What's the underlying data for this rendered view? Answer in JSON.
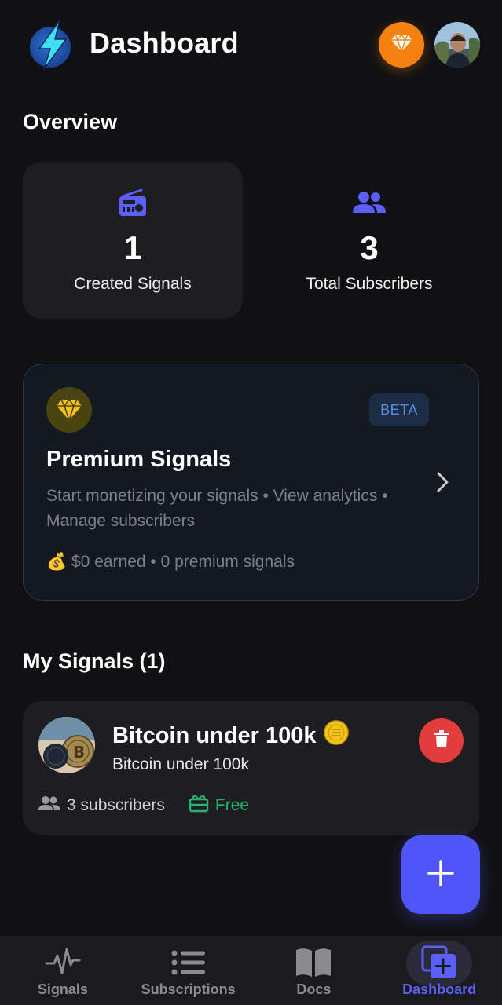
{
  "header": {
    "title": "Dashboard",
    "logo_icon": "lightning-bolt-logo",
    "premium_icon": "diamond-icon",
    "avatar": "user-avatar"
  },
  "overview": {
    "title": "Overview",
    "created": {
      "value": "1",
      "label": "Created Signals",
      "icon": "radio-icon"
    },
    "subscribers": {
      "value": "3",
      "label": "Total Subscribers",
      "icon": "group-icon"
    }
  },
  "premium": {
    "badge": "BETA",
    "title": "Premium Signals",
    "description": "Start monetizing your signals • View analytics • Manage subscribers",
    "stats_emoji": "💰",
    "stats": "$0 earned • 0 premium signals"
  },
  "my_signals": {
    "title": "My Signals (1)",
    "items": [
      {
        "name": "Bitcoin under 100k",
        "name_emoji": "🪙",
        "description": "Bitcoin under 100k",
        "subscribers": "3 subscribers",
        "price": "Free"
      }
    ]
  },
  "nav": {
    "items": [
      {
        "label": "Signals",
        "icon": "pulse-icon"
      },
      {
        "label": "Subscriptions",
        "icon": "list-icon"
      },
      {
        "label": "Docs",
        "icon": "book-icon"
      },
      {
        "label": "Dashboard",
        "icon": "dashboard-add-icon"
      }
    ],
    "active": "Dashboard"
  },
  "colors": {
    "background": "#111113",
    "card": "#1e1e21",
    "accent": "#4f55f6",
    "premium_orange": "#f5820f",
    "danger": "#e23d3d",
    "free_green": "#22b573",
    "gold": "#f2c418"
  }
}
